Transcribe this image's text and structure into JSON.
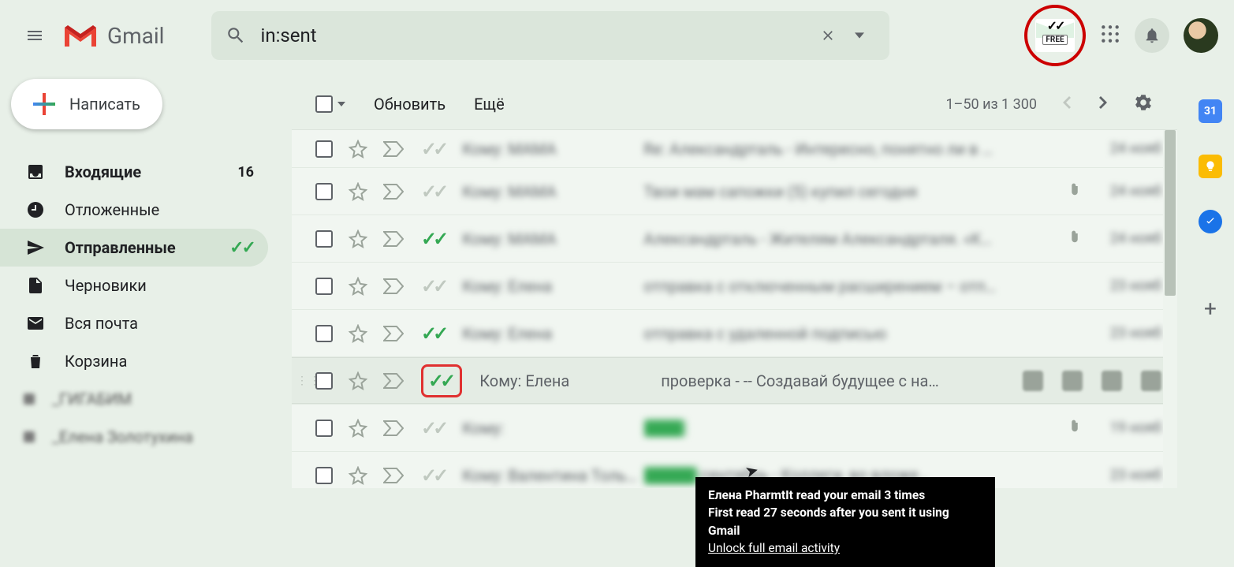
{
  "header": {
    "product": "Gmail",
    "search_value": "in:sent",
    "extension_label": "FREE"
  },
  "compose_label": "Написать",
  "sidebar": {
    "items": [
      {
        "label": "Входящие",
        "count": "16",
        "bold": true
      },
      {
        "label": "Отложенные"
      },
      {
        "label": "Отправленные",
        "active": true,
        "checks": "✓✓"
      },
      {
        "label": "Черновики"
      },
      {
        "label": "Вся почта"
      },
      {
        "label": "Корзина"
      }
    ],
    "user_labels": [
      {
        "label": "_ГИГАБИМ"
      },
      {
        "label": "_Елена Золотухина"
      }
    ]
  },
  "toolbar": {
    "refresh": "Обновить",
    "more": "Ещё",
    "page_text": "1–50 из 1 300"
  },
  "rows": [
    {
      "track": "grey",
      "sender": "Кому: МАМА",
      "subject": "Re: Александрталь - Интересно, понятно ли в …",
      "date": "24 нояб",
      "attach": false
    },
    {
      "track": "grey",
      "sender": "Кому: МАМА",
      "subject": "Твои мам сапожки (5) купил сегодня",
      "date": "24 нояб",
      "attach": true
    },
    {
      "track": "green",
      "sender": "Кому: МАМА",
      "subject": "Александрталь - Жителям Александрталя. «К…",
      "date": "24 нояб",
      "attach": true
    },
    {
      "track": "grey",
      "sender": "Кому: Елена",
      "subject": "отправка с отключенным расширением – отп…",
      "date": "23 нояб",
      "attach": false
    },
    {
      "track": "green",
      "sender": "Кому: Елена",
      "subject": "отправка с удаленной подписью",
      "date": "23 нояб",
      "attach": false
    },
    {
      "track": "green",
      "boxed": true,
      "hover": true,
      "sender": "Кому: Елена",
      "subject": "проверка - -- Создавай будущее с на…",
      "date": "",
      "attach": false
    },
    {
      "track": "grey",
      "sender": "Кому: ",
      "subject": "",
      "chip": true,
      "date": "19 нояб",
      "attach": true
    },
    {
      "track": "grey",
      "sender": "Кому: Валентина Толь…",
      "subject": "",
      "chip": true,
      "subtail": " сентябрь - Коллеги, во вложе…",
      "date": "23 нояб",
      "attach": false
    }
  ],
  "tooltip": {
    "line1": "Елена PharmtIt read your email 3 times",
    "line2": "First read 27 seconds after you sent it using Gmail",
    "line3": "Unlock full email activity"
  },
  "rightstrip": {
    "cal": "31"
  }
}
